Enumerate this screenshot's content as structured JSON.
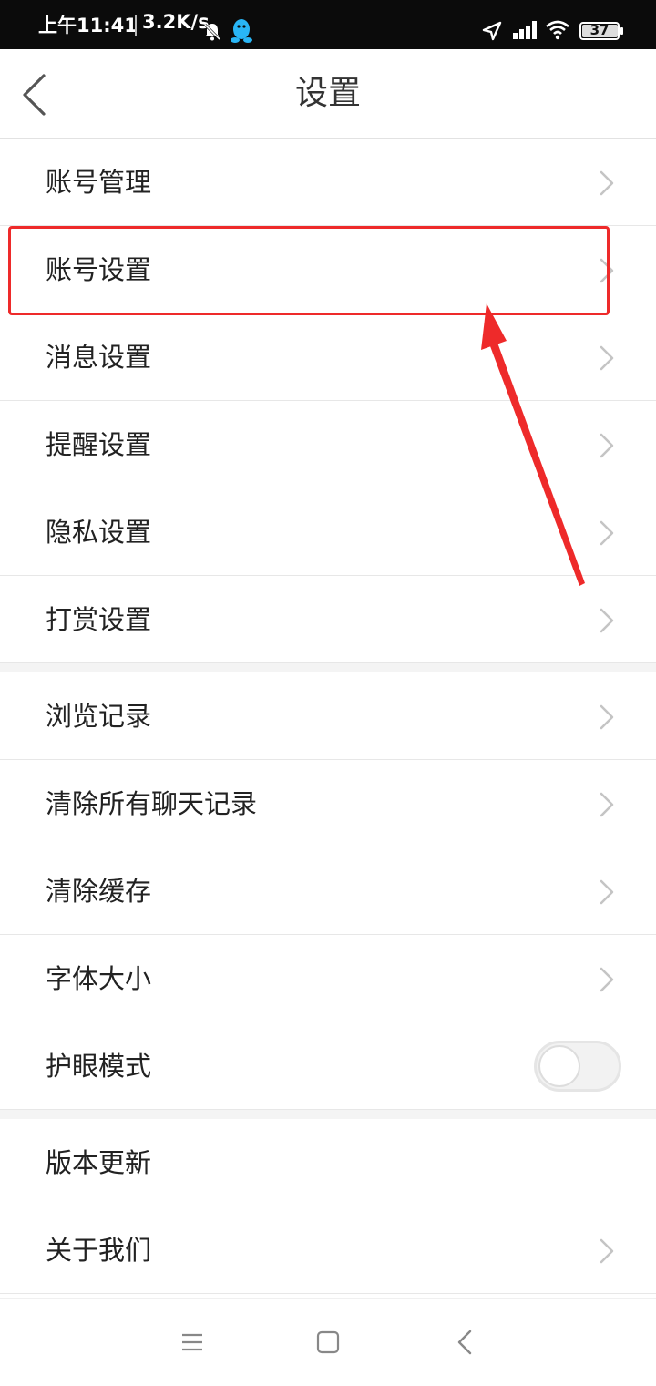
{
  "status_bar": {
    "time": "上午11:41",
    "speed": "3.2K/s",
    "battery": "37",
    "icons": [
      "bell-mute-icon",
      "qq-penguin-icon",
      "location-icon",
      "signal-icon",
      "wifi-icon",
      "battery-icon"
    ]
  },
  "header": {
    "title": "设置",
    "back_icon": "chevron-left-icon"
  },
  "groups": [
    {
      "items": [
        {
          "label": "账号管理",
          "control": "chevron"
        },
        {
          "label": "账号设置",
          "control": "chevron",
          "highlighted": true
        },
        {
          "label": "消息设置",
          "control": "chevron"
        },
        {
          "label": "提醒设置",
          "control": "chevron"
        },
        {
          "label": "隐私设置",
          "control": "chevron"
        },
        {
          "label": "打赏设置",
          "control": "chevron"
        }
      ]
    },
    {
      "items": [
        {
          "label": "浏览记录",
          "control": "chevron"
        },
        {
          "label": "清除所有聊天记录",
          "control": "chevron"
        },
        {
          "label": "清除缓存",
          "control": "chevron"
        },
        {
          "label": "字体大小",
          "control": "chevron"
        },
        {
          "label": "护眼模式",
          "control": "toggle",
          "toggle_on": false
        }
      ]
    },
    {
      "items": [
        {
          "label": "版本更新",
          "control": "none"
        },
        {
          "label": "关于我们",
          "control": "chevron"
        }
      ]
    }
  ],
  "annotation": {
    "highlight_color": "#ee2a2a",
    "target": "账号设置"
  },
  "nav_bar": {
    "icons": [
      "menu-icon",
      "home-square-icon",
      "back-triangle-icon"
    ]
  },
  "colors": {
    "status_bar_bg": "#0b0b0b",
    "text_primary": "#222222",
    "chevron": "#c4c4c4",
    "divider": "#e7e7e7"
  }
}
